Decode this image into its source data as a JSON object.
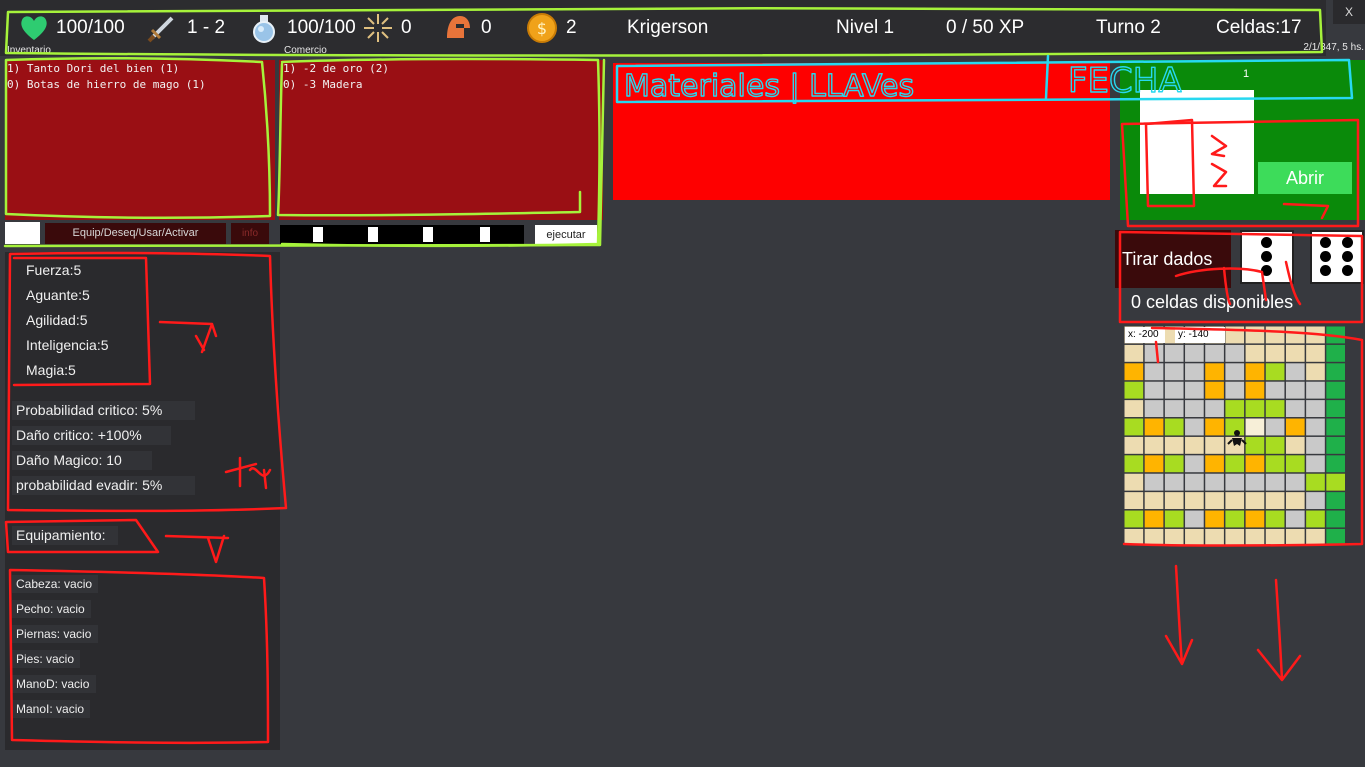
{
  "window": {
    "close_label": "X",
    "datetime": "2/1/347, 5 hs."
  },
  "topbar": {
    "health": "100/100",
    "damage": "1 - 2",
    "mana": "100/100",
    "magic": "0",
    "armor": "0",
    "gold": "2",
    "player_name": "Krigerson",
    "level": "Nivel 1",
    "xp": "0 / 50 XP",
    "turn": "Turno 2",
    "cells": "Celdas:17",
    "icons": [
      "heart-icon",
      "sword-icon",
      "potion-icon",
      "sparkle-icon",
      "helmet-icon",
      "coin-icon"
    ]
  },
  "inventory": {
    "label": "Inventario",
    "items": [
      "1) Tanto Dori del bien (1)",
      "0) Botas de hierro de mago (1)"
    ],
    "equip_button": "Equip/Deseq/Usar/Activar",
    "info_button": "info"
  },
  "crafting": {
    "label": "Comercio",
    "items": [
      "1) -2 de oro (2)",
      "0) -3 Madera"
    ],
    "execute_button": "ejecutar"
  },
  "attributes": [
    "Fuerza:5",
    "Aguante:5",
    "Agilidad:5",
    "Inteligencia:5",
    "Magia:5"
  ],
  "derived_stats": [
    "Probabilidad critico: 5%",
    "Daño critico: +100%",
    "Daño Magico: 10",
    "probabilidad evadir: 5%"
  ],
  "equipment": {
    "title": "Equipamiento:",
    "slots": [
      "Cabeza: vacio",
      "Pecho: vacio",
      "Piernas: vacio",
      "Pies: vacio",
      "ManoD: vacio",
      "ManoI: vacio"
    ]
  },
  "chest": {
    "counter": "1",
    "open_button": "Abrir"
  },
  "dice": {
    "roll_button": "Tirar dados",
    "die1": 3,
    "die2": 6,
    "available_cells": "0 celdas disponibles"
  },
  "minimap": {
    "x": "x: -200",
    "y": "y: -140"
  },
  "annotations": {
    "materials": "Materiales | LLAVes",
    "date": "FECHA"
  },
  "colors": {
    "inventory_bg": "#9a0f14",
    "banner_red": "#fe0000",
    "chest_green": "#0a8a0a",
    "open_button": "#3ddc5a",
    "annotation_red": "#ff1a1a",
    "annotation_lime": "#a6f23b",
    "annotation_cyan": "#27d8f0"
  }
}
